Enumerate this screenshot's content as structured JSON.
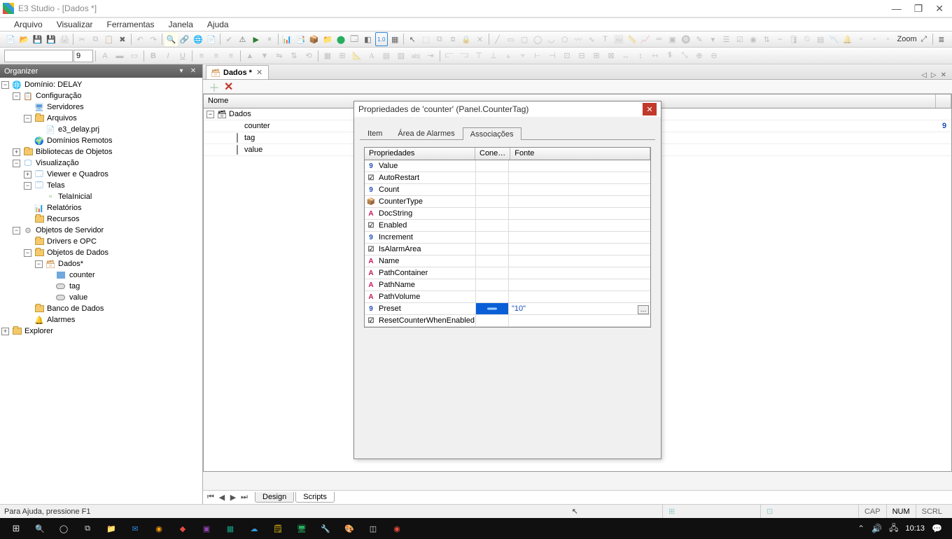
{
  "title": "E3 Studio - [Dados *]",
  "menus": [
    "Arquivo",
    "Visualizar",
    "Ferramentas",
    "Janela",
    "Ajuda"
  ],
  "font_size": "9",
  "zoom_label": "Zoom",
  "organizer": {
    "title": "Organizer",
    "tree": {
      "domain": "Domínio: DELAY",
      "config": "Configuração",
      "servidores": "Servidores",
      "arquivos": "Arquivos",
      "prj": "e3_delay.prj",
      "dom_rem": "Domínios Remotos",
      "bib": "Bibliotecas de Objetos",
      "vis": "Visualização",
      "viewer": "Viewer e Quadros",
      "telas": "Telas",
      "tela_ini": "TelaInicial",
      "relatorios": "Relatórios",
      "recursos": "Recursos",
      "obj_serv": "Objetos de Servidor",
      "drivers": "Drivers e OPC",
      "obj_dados": "Objetos de Dados",
      "dados": "Dados*",
      "counter": "counter",
      "tag": "tag",
      "value": "value",
      "banco": "Banco de Dados",
      "alarmes": "Alarmes",
      "explorer": "Explorer"
    }
  },
  "doc_tab": "Dados *",
  "grid": {
    "header_nome": "Nome",
    "root": "Dados",
    "rows": [
      {
        "name": "counter",
        "val": "9",
        "icon": "box"
      },
      {
        "name": "tag",
        "val": "",
        "icon": "pill"
      },
      {
        "name": "value",
        "val": "",
        "icon": "pill"
      }
    ]
  },
  "modal": {
    "title": "Propriedades de 'counter' (Panel.CounterTag)",
    "tabs": [
      "Item",
      "Área de Alarmes",
      "Associações"
    ],
    "active_tab": 2,
    "headers": {
      "prop": "Propriedades",
      "con": "Cone…",
      "fonte": "Fonte"
    },
    "props": [
      {
        "t": "num",
        "name": "Value"
      },
      {
        "t": "bool",
        "name": "AutoRestart"
      },
      {
        "t": "num",
        "name": "Count"
      },
      {
        "t": "enum",
        "name": "CounterType"
      },
      {
        "t": "str",
        "name": "DocString"
      },
      {
        "t": "bool",
        "name": "Enabled"
      },
      {
        "t": "num",
        "name": "Increment"
      },
      {
        "t": "bool",
        "name": "IsAlarmArea"
      },
      {
        "t": "str",
        "name": "Name"
      },
      {
        "t": "str",
        "name": "PathContainer"
      },
      {
        "t": "str",
        "name": "PathName"
      },
      {
        "t": "str",
        "name": "PathVolume"
      },
      {
        "t": "num",
        "name": "Preset",
        "con": true,
        "fonte": "\"10\""
      },
      {
        "t": "bool",
        "name": "ResetCounterWhenEnabled"
      }
    ]
  },
  "bottom_tabs": {
    "design": "Design",
    "scripts": "Scripts"
  },
  "status": {
    "help": "Para Ajuda, pressione F1",
    "cap": "CAP",
    "num": "NUM",
    "scrl": "SCRL"
  },
  "clock": "10:13"
}
